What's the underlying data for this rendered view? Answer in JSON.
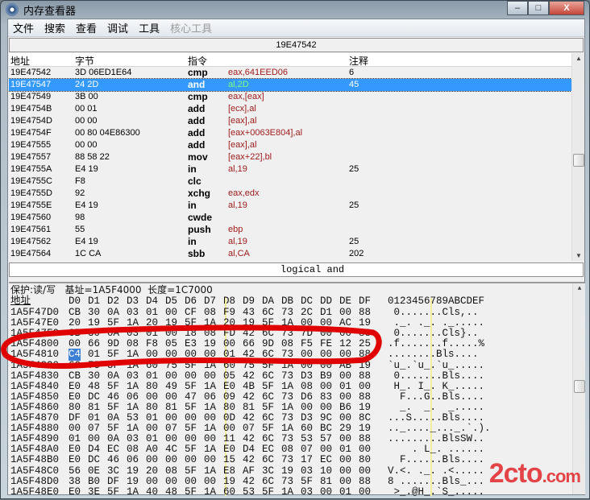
{
  "window": {
    "title": "内存查看器",
    "min": "–",
    "max": "□",
    "close": "X"
  },
  "menu": [
    {
      "label": "文件",
      "enabled": true
    },
    {
      "label": "搜索",
      "enabled": true
    },
    {
      "label": "查看",
      "enabled": true
    },
    {
      "label": "调试",
      "enabled": true
    },
    {
      "label": "工具",
      "enabled": true
    },
    {
      "label": "核心工具",
      "enabled": false
    }
  ],
  "disasm": {
    "current_address": "19E47542",
    "columns": [
      "地址",
      "字节",
      "指令",
      "注释"
    ],
    "rows": [
      {
        "addr": "19E47542",
        "bytes": "3D 06ED1E64",
        "mn": "cmp",
        "op": "eax,641EED06",
        "cm": "6"
      },
      {
        "addr": "19E47547",
        "bytes": "24 2D",
        "mn": "and",
        "op": "al,2D",
        "cm": "45",
        "selected": true
      },
      {
        "addr": "19E47549",
        "bytes": "3B 00",
        "mn": "cmp",
        "op": "eax,[eax]",
        "cm": ""
      },
      {
        "addr": "19E4754B",
        "bytes": "00 01",
        "mn": "add",
        "op": "[ecx],al",
        "cm": ""
      },
      {
        "addr": "19E4754D",
        "bytes": "00 00",
        "mn": "add",
        "op": "[eax],al",
        "cm": ""
      },
      {
        "addr": "19E4754F",
        "bytes": "00 80 04E86300",
        "mn": "add",
        "op": "[eax+0063E804],al",
        "cm": ""
      },
      {
        "addr": "19E47555",
        "bytes": "00 00",
        "mn": "add",
        "op": "[eax],al",
        "cm": ""
      },
      {
        "addr": "19E47557",
        "bytes": "88 58 22",
        "mn": "mov",
        "op": "[eax+22],bl",
        "cm": ""
      },
      {
        "addr": "19E4755A",
        "bytes": "E4 19",
        "mn": "in",
        "op": "al,19",
        "cm": "25"
      },
      {
        "addr": "19E4755C",
        "bytes": "F8",
        "mn": "clc",
        "op": "",
        "cm": ""
      },
      {
        "addr": "19E4755D",
        "bytes": "92",
        "mn": "xchg",
        "op": "eax,edx",
        "cm": ""
      },
      {
        "addr": "19E4755E",
        "bytes": "E4 19",
        "mn": "in",
        "op": "al,19",
        "cm": "25"
      },
      {
        "addr": "19E47560",
        "bytes": "98",
        "mn": "cwde",
        "op": "",
        "cm": ""
      },
      {
        "addr": "19E47561",
        "bytes": "55",
        "mn": "push",
        "op": "ebp",
        "cm": ""
      },
      {
        "addr": "19E47562",
        "bytes": "E4 19",
        "mn": "in",
        "op": "al,19",
        "cm": "25"
      },
      {
        "addr": "19E47564",
        "bytes": "1C CA",
        "mn": "sbb",
        "op": "al,CA",
        "cm": "202"
      }
    ],
    "status": "logical and"
  },
  "hex": {
    "info": "保护:读/写   基址=1A5F4000  长度=1C7000",
    "addr_header": "地址",
    "columns": [
      "D0",
      "D1",
      "D2",
      "D3",
      "D4",
      "D5",
      "D6",
      "D7",
      "D8",
      "D9",
      "DA",
      "DB",
      "DC",
      "DD",
      "DE",
      "DF"
    ],
    "ascii_header": "0123456789ABCDEF",
    "rows": [
      {
        "addr": "1A5F47D0",
        "bytes": "CB 30 0A 03 01 00 CF 08 F9 43 6C 73 2C D1 00 88",
        "ascii": " 0.......Cls,.."
      },
      {
        "addr": "1A5F47E0",
        "bytes": "20 19 5F 1A 20 19 5F 1A 20 19 5F 1A 00 00 AC 19",
        "ascii": " ._. ._. ._....."
      },
      {
        "addr": "1A5F47F0",
        "bytes": "CB 30 0A 03 01 00 18 08 FD 42 6C 73 7D 00 00 88",
        "ascii": " 0.......Cls}.."
      },
      {
        "addr": "1A5F4800",
        "bytes": "00 66 9D 08 F8 05 E3 19 00 66 9D 08 F5 FE 12 25",
        "ascii": ".f.......f.....%"
      },
      {
        "addr": "1A5F4810",
        "bytes": "C4 01 5F 1A 00 00 00 00 01 42 6C 73 00 00 00 88",
        "ascii": "........Bls...."
      },
      {
        "addr": "1A5F4820",
        "bytes": "60 75 5F 1A 60 75 5F 1A 60 75 5F 1A 00 00 AB 19",
        "ascii": "`u_.`u_.`u_....."
      },
      {
        "addr": "1A5F4830",
        "bytes": "CB 30 0A 03 01 00 00 00 05 42 6C 73 D3 B9 00 88",
        "ascii": " 0.......Bls...."
      },
      {
        "addr": "1A5F4840",
        "bytes": "E0 48 5F 1A 80 49 5F 1A E0 4B 5F 1A 08 00 01 00",
        "ascii": " H_. I_. K_....."
      },
      {
        "addr": "1A5F4850",
        "bytes": "E0 DC 46 06 00 00 47 06 09 42 6C 73 D6 83 00 88",
        "ascii": "  F...G..Bls...."
      },
      {
        "addr": "1A5F4860",
        "bytes": "80 81 5F 1A 80 81 5F 1A 80 81 5F 1A 00 00 B6 19",
        "ascii": "  _.  _.  _....."
      },
      {
        "addr": "1A5F4870",
        "bytes": "DF 01 0A 53 01 00 00 00 0D 42 6C 73 D3 9C 00 8C",
        "ascii": "...S.....Bls...."
      },
      {
        "addr": "1A5F4880",
        "bytes": "00 07 5F 1A 00 07 5F 1A 00 07 5F 1A 60 BC 29 19",
        "ascii": ".._...._..._.`.)."
      },
      {
        "addr": "1A5F4890",
        "bytes": "01 00 0A 03 01 00 00 00 11 42 6C 73 53 57 00 88",
        "ascii": ".........BlsSW.."
      },
      {
        "addr": "1A5F48A0",
        "bytes": "E0 D4 EC 08 A0 4C 5F 1A E0 D4 EC 08 07 00 01 00",
        "ascii": "    . L_. ......"
      },
      {
        "addr": "1A5F48B0",
        "bytes": "E0 DC 46 06 00 00 00 00 15 42 6C 73 17 EC 00 80",
        "ascii": "  F......Bls...."
      },
      {
        "addr": "1A5F48C0",
        "bytes": "56 0E 3C 19 20 08 5F 1A E8 AF 3C 19 03 10 00 00",
        "ascii": "V.<. ._. .<....."
      },
      {
        "addr": "1A5F48D0",
        "bytes": "38 B0 DF 19 00 00 00 00 19 42 6C 73 5F 81 00 88",
        "ascii": "8 .......Bls_..."
      },
      {
        "addr": "1A5F48E0",
        "bytes": "E0 3E 5F 1A 40 48 5F 1A 60 53 5F 1A 03 00 01 00",
        "ascii": " >_.@H_.`S_....."
      }
    ]
  },
  "watermark": {
    "text": "2cto",
    "suffix": ".com"
  },
  "colors": {
    "selection": "#3399ff",
    "annotation": "#e00000",
    "operand": "#a01c1c"
  }
}
